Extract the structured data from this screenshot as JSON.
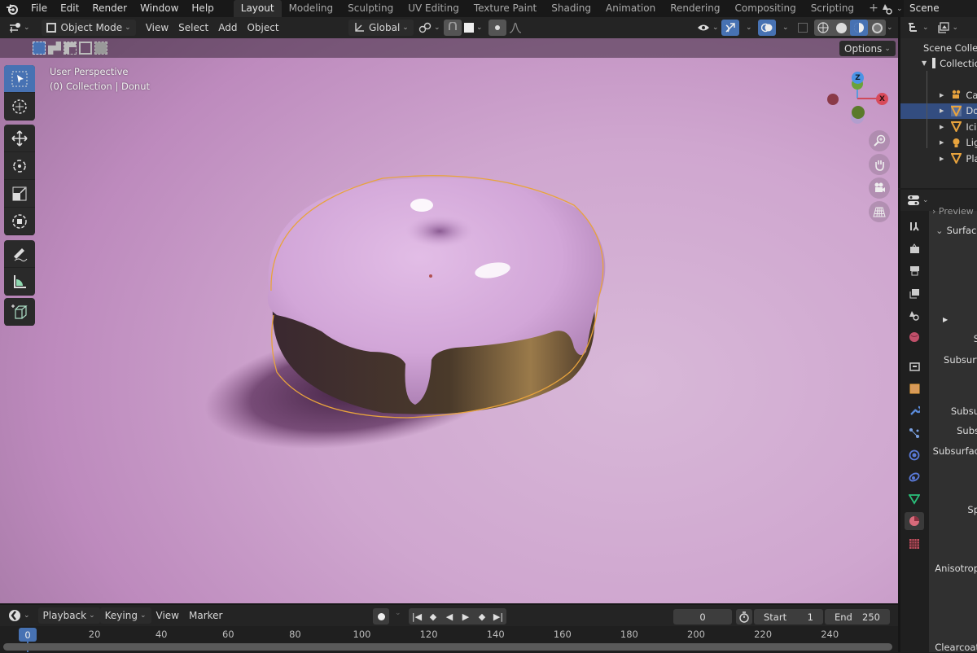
{
  "topbar": {
    "menus": [
      "File",
      "Edit",
      "Render",
      "Window",
      "Help"
    ],
    "workspaces": [
      "Layout",
      "Modeling",
      "Sculpting",
      "UV Editing",
      "Texture Paint",
      "Shading",
      "Animation",
      "Rendering",
      "Compositing",
      "Scripting"
    ],
    "active_workspace": "Layout",
    "add_workspace": "+",
    "scene_name": "Scene"
  },
  "viewport_header": {
    "mode": "Object Mode",
    "menus": [
      "View",
      "Select",
      "Add",
      "Object"
    ],
    "transform_orientation": "Global",
    "options_label": "Options"
  },
  "viewport": {
    "perspective_label": "User Perspective",
    "collection_label": "(0) Collection | Donut",
    "gizmo_axes": {
      "z": "Z",
      "x": "X"
    },
    "tools": [
      "select-box",
      "cursor",
      "move",
      "rotate",
      "scale",
      "transform",
      "annotate",
      "measure",
      "add-cube"
    ],
    "active_tool": "select-box",
    "nav_buttons": [
      "zoom",
      "pan",
      "camera",
      "perspective-toggle"
    ],
    "selection_outline_color": "#e8a33d"
  },
  "outliner": {
    "root": "Scene Collection",
    "collection": "Collection",
    "items": [
      {
        "label": "Camera",
        "visible_text": "Ca",
        "icon": "camera",
        "selected": false
      },
      {
        "label": "Donut",
        "visible_text": "Do",
        "icon": "mesh",
        "selected": true
      },
      {
        "label": "Icing",
        "visible_text": "Icin",
        "icon": "mesh",
        "selected": false
      },
      {
        "label": "Light",
        "visible_text": "Lig",
        "icon": "light",
        "selected": false
      },
      {
        "label": "Plane",
        "visible_text": "Pla",
        "icon": "mesh",
        "selected": false
      }
    ]
  },
  "properties": {
    "preview_label": "Preview",
    "surface_label": "Surface",
    "field_labels": [
      "S",
      "Subsurf",
      "Subsu",
      "Subs",
      "Subsurfac",
      "Sp",
      "Anisotrop",
      "Clearcoat"
    ],
    "tabs": [
      "tool",
      "render",
      "output",
      "view-layer",
      "scene",
      "world",
      "collection",
      "object",
      "modifiers",
      "particles",
      "physics",
      "constraints",
      "data",
      "material",
      "texture"
    ],
    "active_tab": "material"
  },
  "timeline": {
    "menus": [
      "Playback",
      "Keying",
      "View",
      "Marker"
    ],
    "current_frame": "0",
    "start_label": "Start",
    "start_value": "1",
    "end_label": "End",
    "end_value": "250",
    "ticks": [
      "20",
      "40",
      "60",
      "80",
      "100",
      "120",
      "140",
      "160",
      "180",
      "200",
      "220",
      "240"
    ],
    "playhead": "0"
  }
}
